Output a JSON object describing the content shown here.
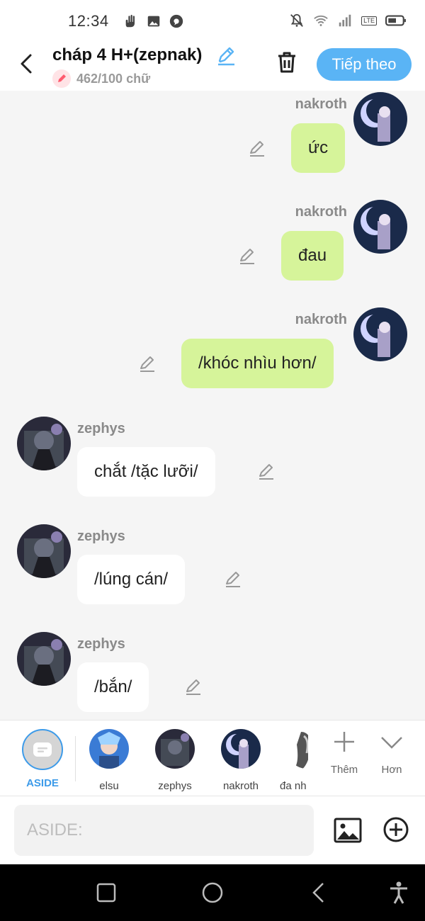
{
  "status_bar": {
    "time": "12:34",
    "left_icons": [
      "hand-icon",
      "image-icon",
      "chat-bubble-icon"
    ],
    "right_icons": [
      "bell-off-icon",
      "wifi-icon",
      "signal-icon",
      "volte-icon",
      "battery-icon"
    ],
    "volte_label": "LTE"
  },
  "header": {
    "title": "cháp 4 H+(zepnak)",
    "word_count": "462/100 chữ",
    "next_button": "Tiếp theo"
  },
  "messages": [
    {
      "side": "right",
      "name": "nakroth",
      "text": "ức"
    },
    {
      "side": "right",
      "name": "nakroth",
      "text": "đau"
    },
    {
      "side": "right",
      "name": "nakroth",
      "text": "/khóc nhìu hơn/"
    },
    {
      "side": "left",
      "name": "zephys",
      "text": "chắt /tặc lưỡi/"
    },
    {
      "side": "left",
      "name": "zephys",
      "text": "/lúng cán/"
    },
    {
      "side": "left",
      "name": "zephys",
      "text": "/bắn/"
    }
  ],
  "characters": [
    {
      "label": "ASIDE",
      "active": true
    },
    {
      "label": "elsu"
    },
    {
      "label": "zephys"
    },
    {
      "label": "nakroth"
    },
    {
      "label": "đa nh"
    }
  ],
  "tools": {
    "add_label": "Thêm",
    "more_label": "Hơn"
  },
  "input": {
    "placeholder": "ASIDE:"
  },
  "colors": {
    "accent": "#5ab4f5",
    "right_bubble": "#d6f49a",
    "left_bubble": "#ffffff",
    "aside_active": "#3d9be9"
  }
}
